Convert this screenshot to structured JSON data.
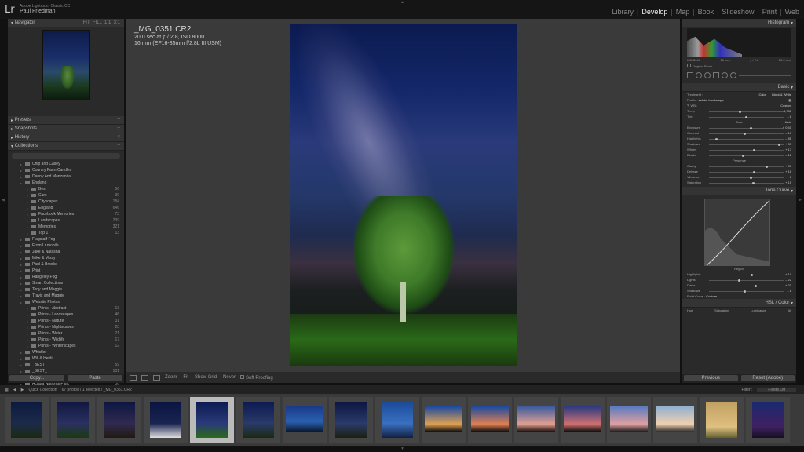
{
  "app": {
    "name": "Adobe Lightroom Classic CC",
    "logo": "Lr",
    "user": "Paul Friedman"
  },
  "modules": [
    "Library",
    "Develop",
    "Map",
    "Book",
    "Slideshow",
    "Print",
    "Web"
  ],
  "active_module": "Develop",
  "left_panel": {
    "navigator": "Navigator",
    "sections": [
      "Presets",
      "Snapshots",
      "History",
      "Collections"
    ],
    "collections": [
      {
        "label": "Chip and Casey",
        "indent": 1,
        "count": ""
      },
      {
        "label": "Country Farm Candles",
        "indent": 1,
        "count": ""
      },
      {
        "label": "Danny And Manzanita",
        "indent": 1,
        "count": ""
      },
      {
        "label": "England",
        "indent": 1,
        "count": ""
      },
      {
        "label": "Best",
        "indent": 2,
        "count": "56"
      },
      {
        "label": "Cars",
        "indent": 2,
        "count": "39"
      },
      {
        "label": "Cityscapes",
        "indent": 2,
        "count": "184"
      },
      {
        "label": "England",
        "indent": 2,
        "count": "646"
      },
      {
        "label": "Facebook Memories",
        "indent": 2,
        "count": "73"
      },
      {
        "label": "Landscapes",
        "indent": 2,
        "count": "239"
      },
      {
        "label": "Memories",
        "indent": 2,
        "count": "321"
      },
      {
        "label": "Top 1",
        "indent": 2,
        "count": "13"
      },
      {
        "label": "Flagstaff Fog",
        "indent": 1,
        "count": ""
      },
      {
        "label": "From Lr mobile",
        "indent": 1,
        "count": ""
      },
      {
        "label": "Jake & Natasha",
        "indent": 1,
        "count": ""
      },
      {
        "label": "Mike & Missy",
        "indent": 1,
        "count": ""
      },
      {
        "label": "Paul & Brooke",
        "indent": 1,
        "count": ""
      },
      {
        "label": "Print",
        "indent": 1,
        "count": ""
      },
      {
        "label": "Rangeley Fog",
        "indent": 1,
        "count": ""
      },
      {
        "label": "Smart Collections",
        "indent": 1,
        "count": ""
      },
      {
        "label": "Tony and Maggie",
        "indent": 1,
        "count": ""
      },
      {
        "label": "Travis and Maggie",
        "indent": 1,
        "count": ""
      },
      {
        "label": "Website Photos",
        "indent": 1,
        "count": ""
      },
      {
        "label": "Prints - Abstract",
        "indent": 2,
        "count": "13"
      },
      {
        "label": "Prints - Landscapes",
        "indent": 2,
        "count": "46"
      },
      {
        "label": "Prints - Nature",
        "indent": 2,
        "count": "31"
      },
      {
        "label": "Prints - Nightscapes",
        "indent": 2,
        "count": "23"
      },
      {
        "label": "Prints - Water",
        "indent": 2,
        "count": "21"
      },
      {
        "label": "Prints - Wildlife",
        "indent": 2,
        "count": "17"
      },
      {
        "label": "Prints - Winterscapes",
        "indent": 2,
        "count": "12"
      },
      {
        "label": "Whistler",
        "indent": 1,
        "count": ""
      },
      {
        "label": "Will & Heidi",
        "indent": 1,
        "count": ""
      },
      {
        "label": "_BEST",
        "indent": 1,
        "count": "59"
      },
      {
        "label": "_BEST_",
        "indent": 1,
        "count": "181"
      },
      {
        "label": "_Wedding Best",
        "indent": 1,
        "count": "27"
      },
      {
        "label": "Acadia National Park",
        "indent": 1,
        "count": "36"
      }
    ],
    "copy": "Copy...",
    "paste": "Paste"
  },
  "photo": {
    "filename": "_MG_0351.CR2",
    "exposure": "20.0 sec at ƒ / 2.8, ISO 8000",
    "lens": "16 mm (EF16-35mm f/2.8L III USM)"
  },
  "toolbar": {
    "zoom": "Zoom",
    "fit": "Fit",
    "show_grid": "Show Grid",
    "never": "Never",
    "soft_proofing": "Soft Proofing"
  },
  "right_panel": {
    "histogram": "Histogram",
    "hist_labels": [
      "ISO 8000",
      "16 mm",
      "ƒ / 2.8",
      "20.0 sec"
    ],
    "original_photo": "Original Photo",
    "basic": "Basic",
    "treatment": "Treatment :",
    "color": "Color",
    "bw": "Black & White",
    "profile": "Profile :",
    "profile_value": "Adobe Landscape",
    "wb": "WB :",
    "wb_value": "Custom",
    "temp": "Temp",
    "temp_v": "3,786",
    "tint": "Tint",
    "tint_v": "– 8",
    "tone": "Tone",
    "auto": "Auto",
    "exposure": "Exposure",
    "exposure_v": "+ 0.41",
    "contrast": "Contrast",
    "contrast_v": "– 10",
    "highlights": "Highlights",
    "highlights_v": "– 85",
    "shadows": "Shadows",
    "shadows_v": "+ 83",
    "whites": "Whites",
    "whites_v": "+ 17",
    "blacks": "Blacks",
    "blacks_v": "– 12",
    "presence": "Presence",
    "clarity": "Clarity",
    "clarity_v": "+ 51",
    "dehaze": "Dehaze",
    "dehaze_v": "+ 16",
    "vibrance": "Vibrance",
    "vibrance_v": "+ 8",
    "saturation": "Saturation",
    "saturation_v": "+ 15",
    "tone_curve": "Tone Curve",
    "region": "Region",
    "r_highlights": "Highlights",
    "r_highlights_v": "+ 10",
    "r_lights": "Lights",
    "r_lights_v": "– 22",
    "r_darks": "Darks",
    "r_darks_v": "+ 21",
    "r_shadows": "Shadows",
    "r_shadows_v": "– 8",
    "point_curve": "Point Curve :",
    "point_curve_v": "Custom",
    "hsl": "HSL / Color",
    "hsl_tabs": [
      "Hue",
      "Saturation",
      "Luminance",
      "All"
    ],
    "previous": "Previous",
    "reset": "Reset (Adobe)"
  },
  "filmstrip_bar": {
    "source": "Quick Collection",
    "info": "67 photos / 1 selected / _MG_0351.CR2",
    "filter": "Filter :",
    "filter_value": "Filters Off"
  }
}
